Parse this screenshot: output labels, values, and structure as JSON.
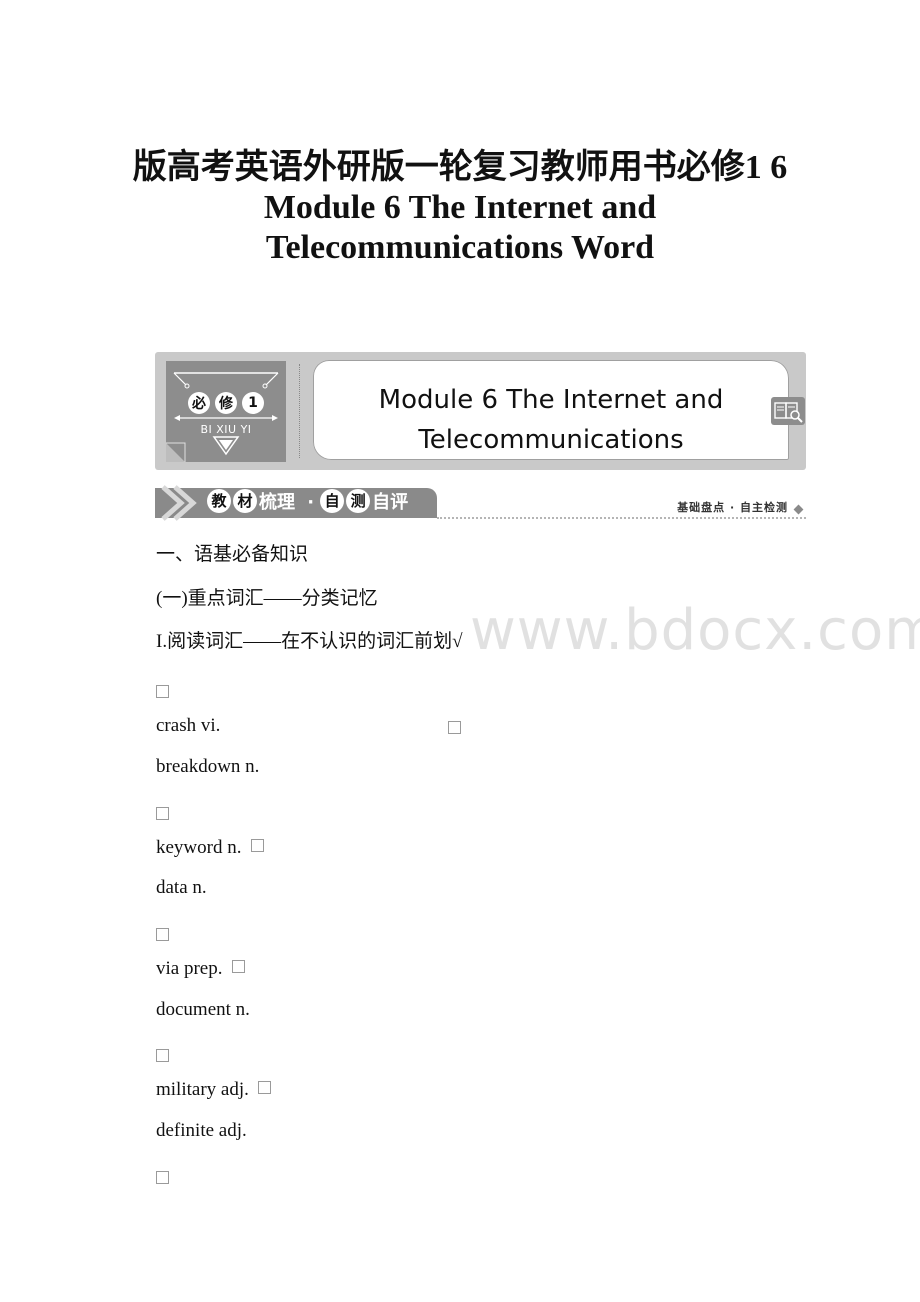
{
  "document": {
    "title_lines": [
      "版高考英语外研版一轮复习教师用书必修1 6",
      "Module 6 The Internet and",
      "Telecommunications Word"
    ]
  },
  "banner": {
    "badge": {
      "chars": [
        "必",
        "修",
        "1"
      ],
      "pinyin": "BI XIU YI"
    },
    "title_lines": [
      "Module 6  The Internet and",
      "Telecommunications"
    ],
    "icon": "book-search-icon"
  },
  "section_bar": {
    "tab_chars_circled_1": [
      "教",
      "材"
    ],
    "tab_text_1": "梳理",
    "separator": "·",
    "tab_chars_circled_2": [
      "自",
      "测"
    ],
    "tab_text_2": "自评",
    "right_label": "基础盘点 · 自主检测"
  },
  "content": {
    "heading1": "一、语基必备知识",
    "heading2": "(一)重点词汇——分类记忆",
    "heading3": "I.阅读词汇——在不认识的词汇前划√",
    "vocab": [
      "crash vi.",
      "breakdown n.",
      "keyword n.",
      "data n.",
      "via prep.",
      "document n.",
      "military adj.",
      "definite adj."
    ]
  },
  "watermark": "www.bdocx.com"
}
